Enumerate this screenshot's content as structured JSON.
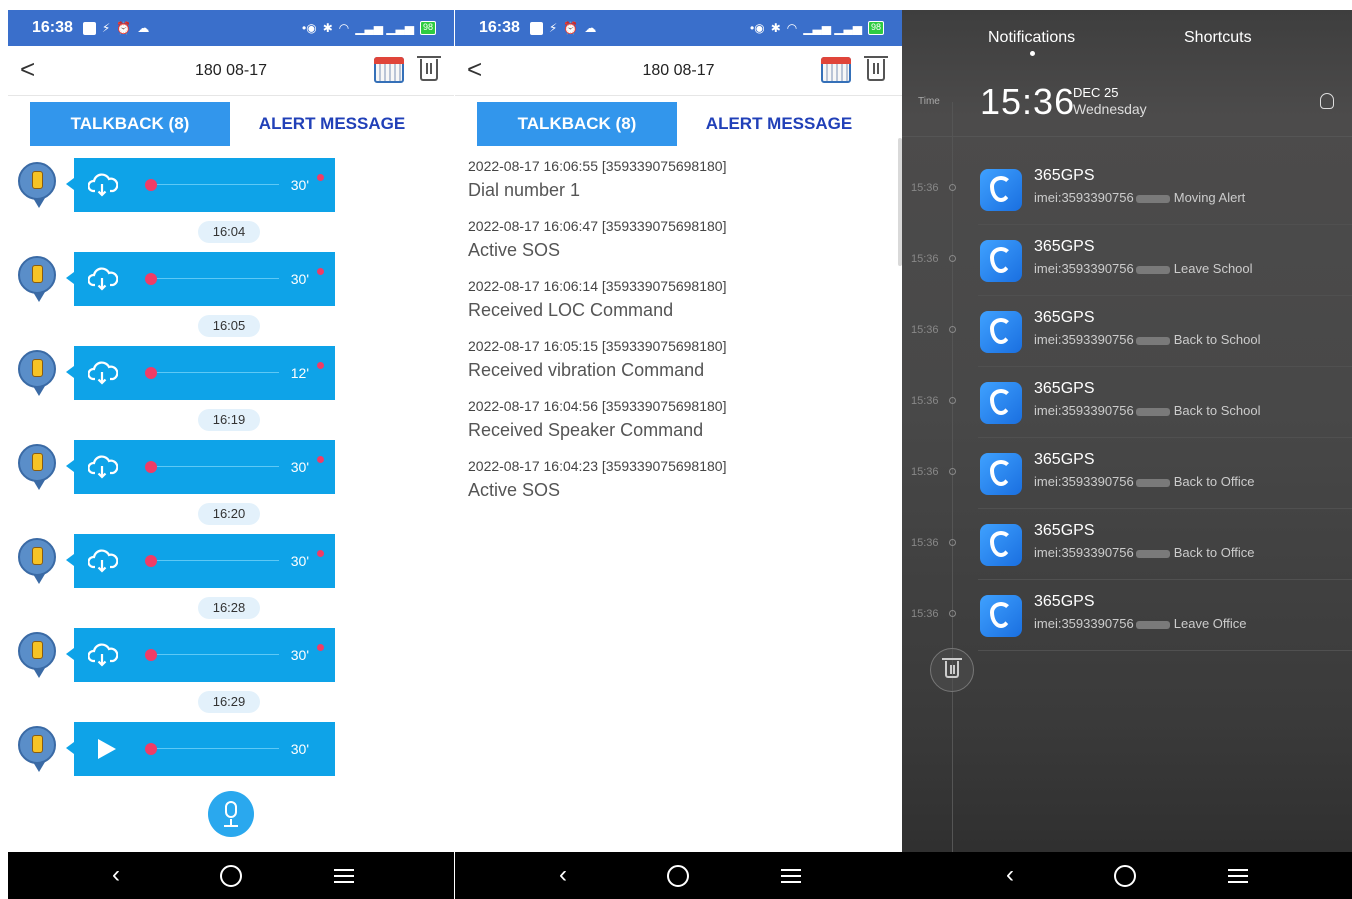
{
  "status": {
    "time": "16:38",
    "battery": "98"
  },
  "header": {
    "title": "180 08-17"
  },
  "tabs": {
    "talkback": "TALKBACK (8)",
    "alert": "ALERT MESSAGE"
  },
  "talkback": {
    "messages": [
      {
        "duration": "30'",
        "time": "16:04"
      },
      {
        "duration": "30'",
        "time": "16:05"
      },
      {
        "duration": "12'",
        "time": "16:19"
      },
      {
        "duration": "30'",
        "time": "16:20"
      },
      {
        "duration": "30'",
        "time": "16:28"
      },
      {
        "duration": "30'",
        "time": "16:29"
      },
      {
        "duration": "30'",
        "time": ""
      }
    ]
  },
  "alerts": [
    {
      "meta": "2022-08-17 16:06:55  [359339075698180]",
      "text": "Dial number 1"
    },
    {
      "meta": "2022-08-17 16:06:47  [359339075698180]",
      "text": "Active SOS"
    },
    {
      "meta": "2022-08-17 16:06:14  [359339075698180]",
      "text": "Received LOC Command"
    },
    {
      "meta": "2022-08-17 16:05:15  [359339075698180]",
      "text": "Received vibration Command"
    },
    {
      "meta": "2022-08-17 16:04:56  [359339075698180]",
      "text": "Received Speaker Command"
    },
    {
      "meta": "2022-08-17 16:04:23  [359339075698180]",
      "text": "Active SOS"
    }
  ],
  "notif": {
    "tab_notifications": "Notifications",
    "tab_shortcuts": "Shortcuts",
    "time_label": "Time",
    "clock": "15:36",
    "date": "DEC 25",
    "weekday": "Wednesday",
    "items": [
      {
        "time": "15:36",
        "app": "365GPS",
        "imei": "imei:3593390756",
        "event": "Moving Alert"
      },
      {
        "time": "15:36",
        "app": "365GPS",
        "imei": "imei:3593390756",
        "event": "Leave School"
      },
      {
        "time": "15:36",
        "app": "365GPS",
        "imei": "imei:3593390756",
        "event": "Back to School"
      },
      {
        "time": "15:36",
        "app": "365GPS",
        "imei": "imei:3593390756",
        "event": "Back to School"
      },
      {
        "time": "15:36",
        "app": "365GPS",
        "imei": "imei:3593390756",
        "event": "Back to Office"
      },
      {
        "time": "15:36",
        "app": "365GPS",
        "imei": "imei:3593390756",
        "event": "Back to Office"
      },
      {
        "time": "15:36",
        "app": "365GPS",
        "imei": "imei:3593390756",
        "event": "Leave Office"
      }
    ]
  },
  "icons": {
    "back": "chevron-left-icon",
    "calendar": "calendar-icon",
    "trash": "trash-icon",
    "cloud": "cloud-download-icon",
    "play": "play-icon",
    "mic": "microphone-icon",
    "bulb": "lightbulb-icon",
    "app": "365gps-app-icon"
  },
  "colors": {
    "statusbar": "#3a6fcb",
    "tab_active": "#3296ec",
    "bubble": "#0ea3e8",
    "accent_red": "#f03c66",
    "tab_text": "#2140b8"
  }
}
